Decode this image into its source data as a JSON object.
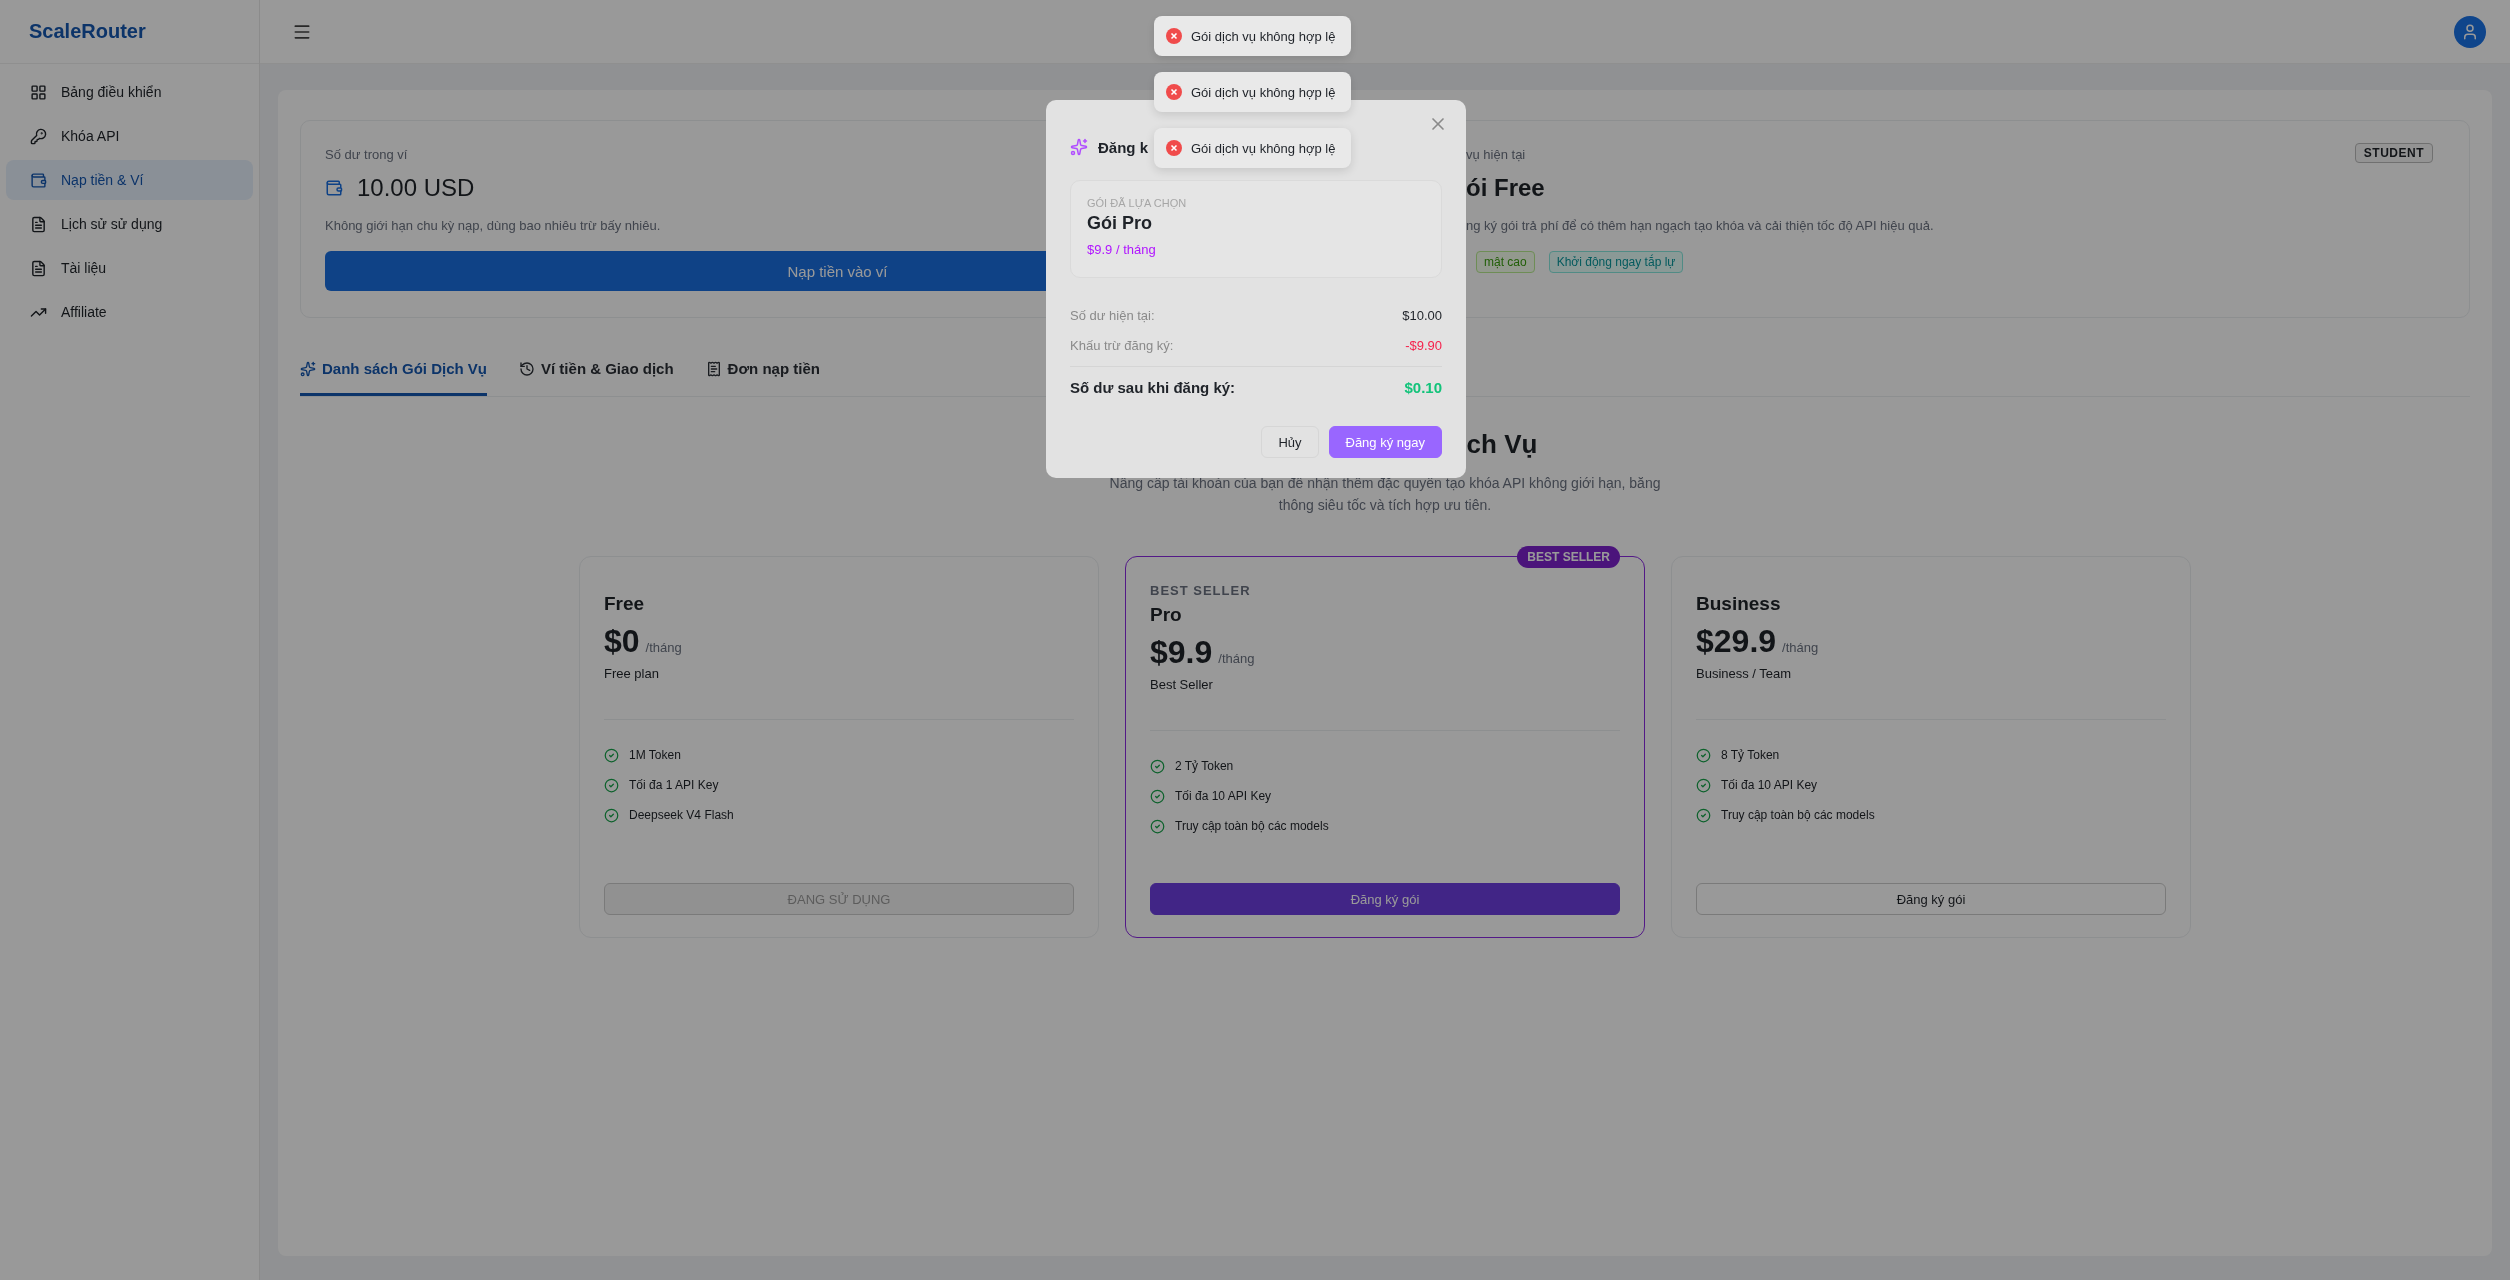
{
  "sidebar": {
    "logo": "ScaleRouter",
    "items": [
      {
        "label": "Bảng điều khiển",
        "selected": false
      },
      {
        "label": "Khóa API",
        "selected": false
      },
      {
        "label": "Nạp tiền & Ví",
        "selected": true
      },
      {
        "label": "Lịch sử sử dụng",
        "selected": false
      },
      {
        "label": "Tài liệu",
        "selected": false
      },
      {
        "label": "Affiliate",
        "selected": false
      }
    ]
  },
  "wallet_card": {
    "label": "Số dư trong ví",
    "balance": "10.00 USD",
    "note": "Không giới hạn chu kỳ nạp, dùng bao nhiêu trừ bấy nhiêu.",
    "button": "Nạp tiền vào ví"
  },
  "plan_card": {
    "label": "vụ hiện tại",
    "title": "ói Free",
    "badge": "STUDENT",
    "description": "ng ký gói trả phí để có thêm hạn ngạch tạo khóa và cải thiện tốc độ API hiệu quả.",
    "tags": [
      {
        "label": "mật cao",
        "kind": "success"
      },
      {
        "label": "Khởi động ngay tắp lự",
        "kind": "info"
      }
    ]
  },
  "tabs": [
    {
      "label": "Danh sách Gói Dịch Vụ",
      "selected": true
    },
    {
      "label": "Ví tiền & Giao dịch",
      "selected": false
    },
    {
      "label": "Đơn nạp tiền",
      "selected": false
    }
  ],
  "pricing": {
    "title": "ch Vụ",
    "subtitle": "Nâng cấp tài khoản của bạn để nhận thêm đặc quyền tạo khóa API không giới hạn, băng thông siêu tốc và tích hợp ưu tiên.",
    "plans": [
      {
        "name": "Free",
        "price": "$0",
        "period": "/tháng",
        "description": "Free plan",
        "features": [
          "1M Token",
          "Tối đa 1 API Key",
          "Deepseek V4 Flash"
        ],
        "button": "ĐANG SỬ DỤNG",
        "current": true,
        "featured": false
      },
      {
        "ribbon": "BEST SELLER",
        "eyebrow": "BEST SELLER",
        "name": "Pro",
        "price": "$9.9",
        "period": "/tháng",
        "description": "Best Seller",
        "features": [
          "2 Tỷ Token",
          "Tối đa 10 API Key",
          "Truy cập toàn bộ các models"
        ],
        "button": "Đăng ký gói",
        "current": false,
        "featured": true
      },
      {
        "name": "Business",
        "price": "$29.9",
        "period": "/tháng",
        "description": "Business / Team",
        "features": [
          "8 Tỷ Token",
          "Tối đa 10 API Key",
          "Truy cập toàn bộ các models"
        ],
        "button": "Đăng ký gói",
        "current": false,
        "featured": false
      }
    ]
  },
  "modal": {
    "title": "Đăng k",
    "selected_label": "GÓI ĐÃ LỰA CHỌN",
    "plan_name": "Gói Pro",
    "plan_price": "$9.9 / tháng",
    "rows": [
      {
        "label": "Số dư hiện tại:",
        "value": "$10.00",
        "kind": "neutral"
      },
      {
        "label": "Khấu trừ đăng ký:",
        "value": "-$9.90",
        "kind": "negative"
      },
      {
        "label": "Số dư sau khi đăng ký:",
        "value": "$0.10",
        "kind": "total"
      }
    ],
    "buttons": [
      {
        "label": "Hủy",
        "kind": "secondary"
      },
      {
        "label": "Đăng ký ngay",
        "kind": "primary"
      }
    ]
  },
  "toasts": [
    {
      "message": "Gói dịch vụ không hợp lệ",
      "kind": "error"
    },
    {
      "message": "Gói dịch vụ không hợp lệ",
      "kind": "error"
    },
    {
      "message": "Gói dịch vụ không hợp lệ",
      "kind": "error"
    }
  ]
}
